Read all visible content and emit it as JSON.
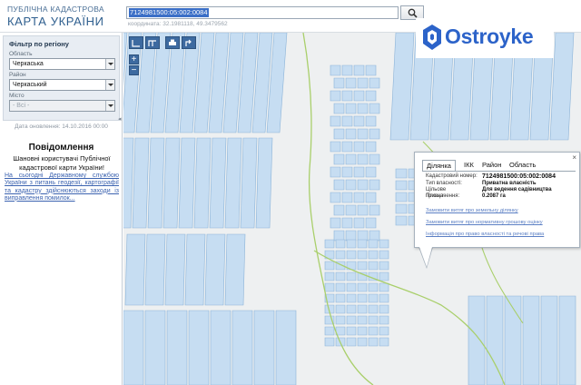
{
  "header": {
    "title_line1": "ПУБЛІЧНА КАДАСТРОВА",
    "title_line2": "КАРТА УКРАЇНИ",
    "search_value": "7124981500:05:002:0084",
    "search_icon": "magnifier-icon",
    "coords": "координата: 32.1981118, 49.3479562"
  },
  "brand": {
    "name": "Ostroyke",
    "color": "#2c63c9"
  },
  "sidebar": {
    "filter_title": "Фільтр по регіону",
    "region_label": "Область",
    "region_value": "Черкаська",
    "district_label": "Район",
    "district_value": "Черкаський",
    "city_label": "Місто",
    "city_value": "- Всі -",
    "collapse_arrow": "◂",
    "updated": "Дата оновлення: 14.10.2016 00:00",
    "notice_title": "Повідомлення",
    "notice_body": "Шановні користувачі Публічної кадастрової карти України!",
    "notice_link": "На сьогодні Державному службою України з питань геодезії, картографії та кадастру здійснюються заходи із виправлення помилок..."
  },
  "map": {
    "tools": [
      "measure-distance-icon",
      "measure-area-icon",
      "print-icon",
      "share-icon"
    ],
    "zoom_in": "+",
    "zoom_out": "−",
    "parcel_color": "#c6ddf2",
    "parcel_border": "#8bb3d8",
    "boundary_color": "#a9cf6b"
  },
  "popup": {
    "close": "×",
    "tabs": [
      "Ділянка",
      "ІКК",
      "Район",
      "Область"
    ],
    "active_tab": "Ділянка",
    "fields": [
      {
        "key": "Кадастровий номер:",
        "value": "7124981500:05:002:0084"
      },
      {
        "key": "Тип власності:",
        "value": "Приватна власність"
      },
      {
        "key": "Цільове призначення:",
        "value": "Для ведення садівництва"
      },
      {
        "key": "Площа:",
        "value": "0.2087 га"
      }
    ],
    "links": [
      "Замовити витяг про земельну ділянку",
      "Замовити витяг про нормативну грошову оцінку",
      "Інформація про право власності та речові права"
    ]
  }
}
